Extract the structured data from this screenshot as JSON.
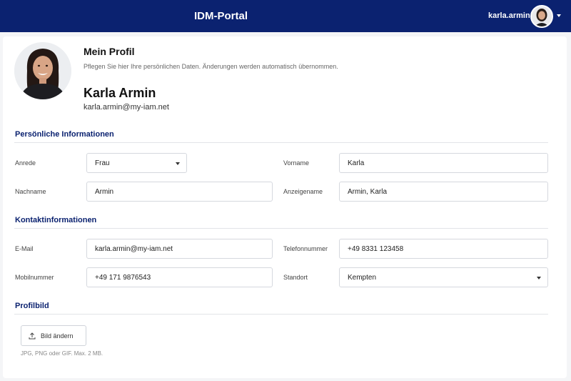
{
  "header": {
    "app_title": "IDM-Portal",
    "username": "karla.armin"
  },
  "profile": {
    "title": "Mein Profil",
    "subtitle": "Pflegen Sie hier Ihre persönlichen Daten. Änderungen werden automatisch übernommen.",
    "full_name": "Karla Armin",
    "email": "karla.armin@my-iam.net"
  },
  "personal": {
    "heading": "Persönliche Informationen",
    "salutation_label": "Anrede",
    "salutation_value": "Frau",
    "firstname_label": "Vorname",
    "firstname_value": "Karla",
    "lastname_label": "Nachname",
    "lastname_value": "Armin",
    "displayname_label": "Anzeigename",
    "displayname_value": "Armin, Karla"
  },
  "contact": {
    "heading": "Kontaktinformationen",
    "email_label": "E-Mail",
    "email_value": "karla.armin@my-iam.net",
    "phone_label": "Telefonnummer",
    "phone_value": "+49 8331 123458",
    "mobile_label": "Mobilnummer",
    "mobile_value": "+49 171 9876543",
    "location_label": "Standort",
    "location_value": "Kempten"
  },
  "picture": {
    "heading": "Profilbild",
    "button_label": "Bild ändern",
    "hint": "JPG, PNG oder GIF. Max. 2 MB."
  },
  "colors": {
    "header_bg": "#0b2270",
    "section_heading": "#0b2270"
  }
}
